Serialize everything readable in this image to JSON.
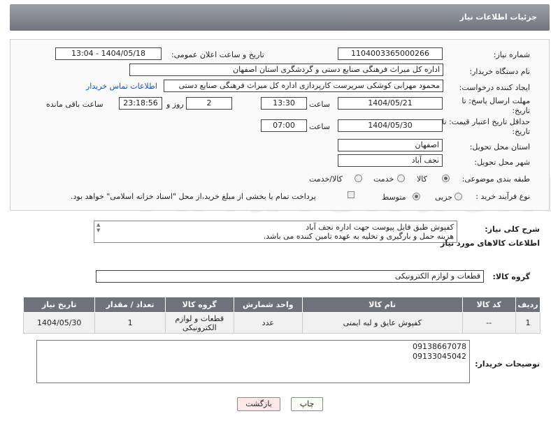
{
  "header": {
    "title": "جزئیات اطلاعات نیاز"
  },
  "form": {
    "need_number_label": "شماره نیاز:",
    "need_number": "1104003365000266",
    "announce_label": "تاریخ و ساعت اعلان عمومی:",
    "announce_value": "1404/05/18 - 13:04",
    "buyer_org_label": "نام دستگاه خریدار:",
    "buyer_org": "اداره کل میراث فرهنگی  صنایع دستی و گردشگری استان اصفهان",
    "requester_label": "ایجاد کننده درخواست:",
    "requester": "محمود مهرابی کوشکی سرپرست کارپردازی اداره کل میراث فرهنگی  صنایع دستی",
    "contact_link": "اطلاعات تماس خریدار",
    "deadline_label": "مهلت ارسال پاسخ: تا تاریخ:",
    "deadline_date": "1404/05/21",
    "time_label": "ساعت",
    "deadline_time": "13:30",
    "days": "2",
    "days_label": "روز و",
    "remaining": "23:18:56",
    "remaining_label": "ساعت باقی مانده",
    "validity_label": "حداقل تاریخ اعتبار قیمت: تا تاریخ:",
    "validity_date": "1404/05/30",
    "validity_time": "07:00",
    "province_label": "استان محل تحویل:",
    "province": "اصفهان",
    "city_label": "شهر محل تحویل:",
    "city": "نجف آباد",
    "category_label": "طبقه بندی موضوعی:",
    "category_options": [
      "کالا",
      "خدمت",
      "کالا/خدمت"
    ],
    "process_label": "نوع فرآیند خرید :",
    "process_options": [
      "جزیی",
      "متوسط"
    ],
    "payment_note": "پرداخت تمام یا بخشی از مبلغ خرید،از محل \"اسناد خزانه اسلامی\" خواهد بود."
  },
  "description": {
    "label": "شرح کلی نیاز:",
    "line1": "کفپوش طبق فایل پیوست جهت اداره نجف آباد",
    "line2": "هزینه حمل و بارگیری و تخلیه به عهده تامین کننده می باشد."
  },
  "goods": {
    "section_title": "اطلاعات کالاهای مورد نیاز",
    "group_label": "گروه کالا:",
    "group_value": "قطعات و لوازم الکترونیکی",
    "columns": [
      "ردیف",
      "کد کالا",
      "نام کالا",
      "واحد شمارش",
      "گروه کالا",
      "تعداد / مقدار",
      "تاریخ نیاز"
    ],
    "rows": [
      {
        "row": "1",
        "code": "--",
        "name": "کفپوش عایق و لبه ایمنی",
        "unit": "عدد",
        "group": "قطعات و لوازم الکترونیکی",
        "qty": "1",
        "date": "1404/05/30"
      }
    ]
  },
  "notes": {
    "label": "توضیحات خریدار:",
    "line1": "09138667078",
    "line2": "09133045042"
  },
  "buttons": {
    "print": "چاپ",
    "back": "بازگشت"
  }
}
